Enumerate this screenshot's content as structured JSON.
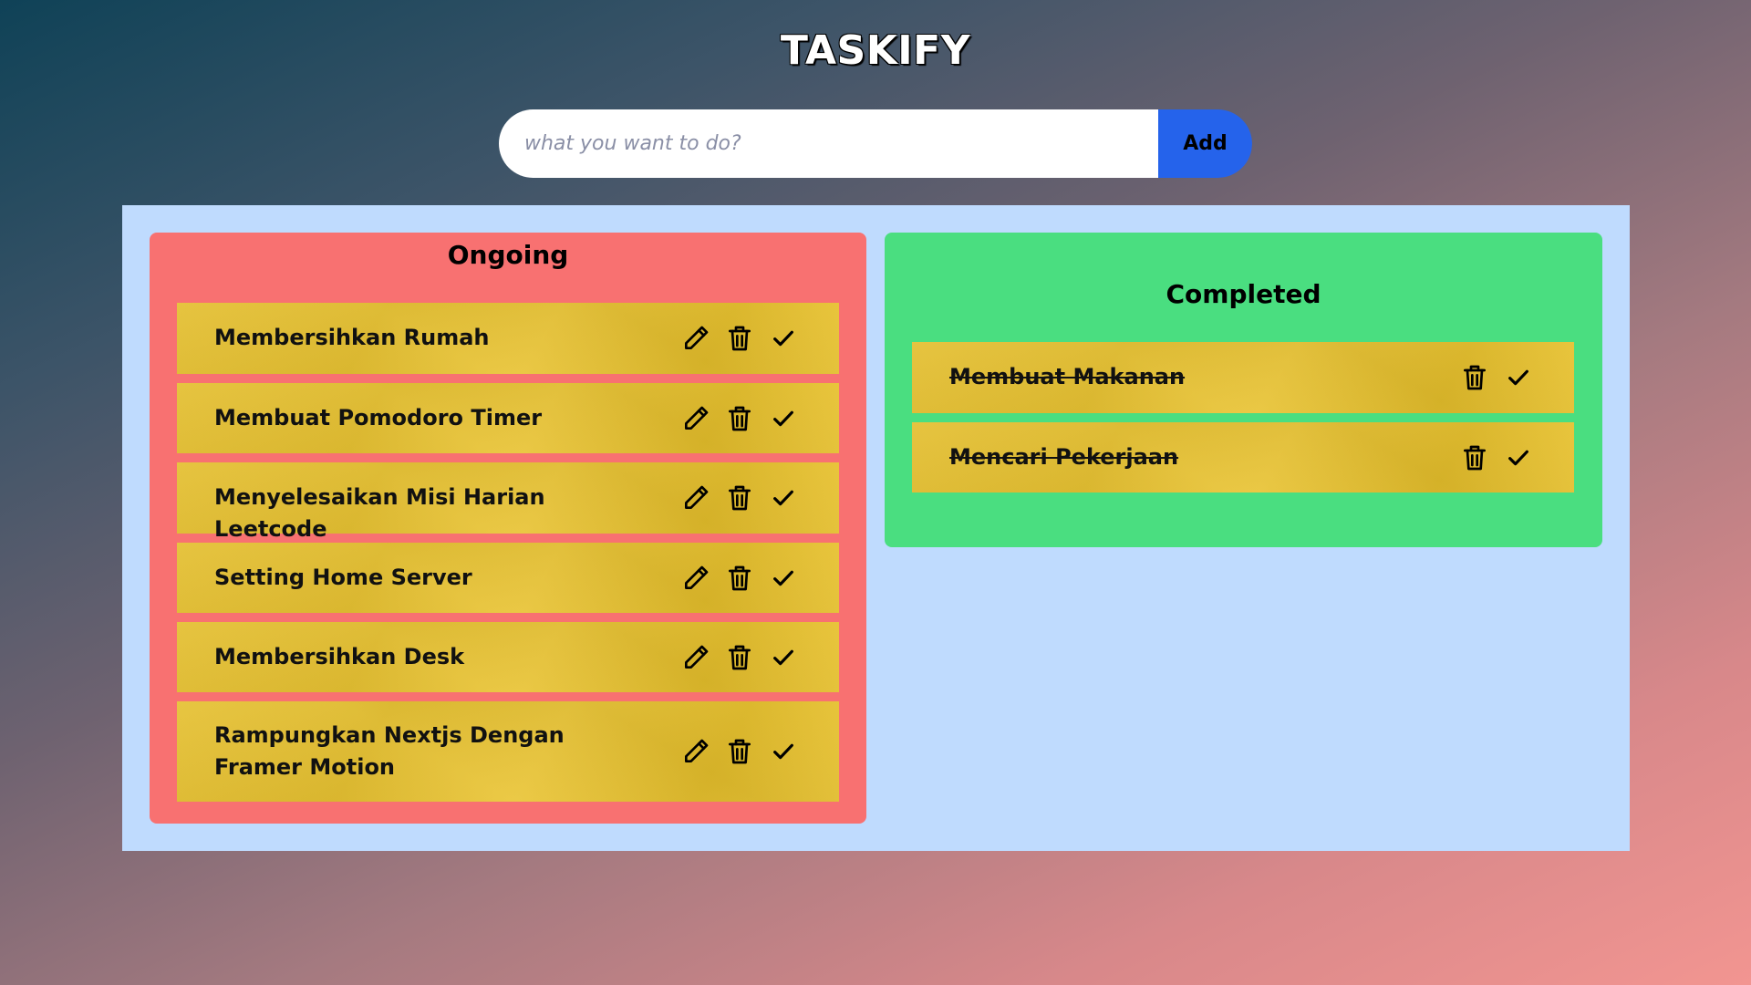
{
  "app": {
    "title": "TASKIFY"
  },
  "input": {
    "placeholder": "what you want to do?",
    "value": ""
  },
  "add_button": {
    "label": "Add"
  },
  "ongoing": {
    "title": "Ongoing",
    "items": [
      {
        "text": "Membersihkan Rumah"
      },
      {
        "text": "Membuat Pomodoro Timer"
      },
      {
        "text": "Menyelesaikan Misi Harian Leetcode"
      },
      {
        "text": "Setting Home Server"
      },
      {
        "text": "Membersihkan Desk"
      },
      {
        "text": "Rampungkan Nextjs Dengan Framer Motion"
      }
    ]
  },
  "completed": {
    "title": "Completed",
    "items": [
      {
        "text": "Membuat Makanan"
      },
      {
        "text": "Mencari Pekerjaan"
      }
    ]
  },
  "colors": {
    "accent": "#2563eb",
    "board": "#bfdbfe",
    "ongoing": "#f87171",
    "completed": "#4ade80",
    "card": "#e9c22c"
  },
  "icons": {
    "edit": "pencil-icon",
    "delete": "trash-icon",
    "done": "check-icon"
  }
}
